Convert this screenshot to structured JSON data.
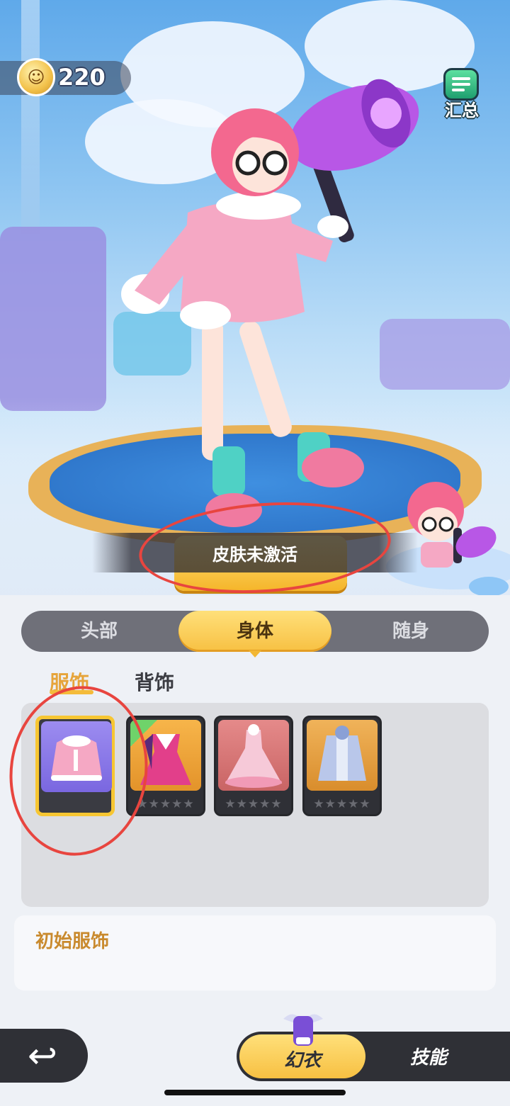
{
  "hud": {
    "currency_amount": "220",
    "summary_label": "汇总"
  },
  "notice": {
    "toast_text": "皮肤未激活"
  },
  "slot_tabs": [
    "头部",
    "身体",
    "随身"
  ],
  "slot_tabs_active": "身体",
  "subtabs": [
    "服饰",
    "背饰"
  ],
  "subtabs_active": "服饰",
  "items": [
    {
      "name": "pink-hoodie",
      "selected": true
    },
    {
      "name": "witch-dress",
      "selected": false,
      "new": true,
      "stars": "★★★★★"
    },
    {
      "name": "princess-dress",
      "selected": false,
      "stars": "★★★★★"
    },
    {
      "name": "mecha-jacket",
      "selected": false,
      "stars": "★★★★★"
    }
  ],
  "description": {
    "title": "初始服饰"
  },
  "bottom_nav": {
    "fashion_label": "幻衣",
    "skill_label": "技能"
  },
  "colors": {
    "accent": "#f7c042",
    "annotation_red": "#e8453f"
  }
}
